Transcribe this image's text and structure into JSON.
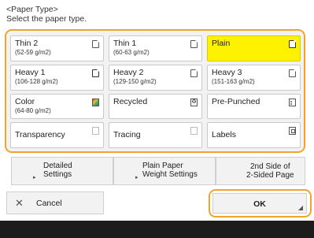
{
  "header": {
    "line1": "<Paper Type>",
    "line2": "Select the paper type."
  },
  "paper_types": [
    {
      "label": "Thin 2",
      "sub": "(52-59 g/m2)",
      "icon": "page-icon",
      "selected": false
    },
    {
      "label": "Thin 1",
      "sub": "(60-63 g/m2)",
      "icon": "page-icon",
      "selected": false
    },
    {
      "label": "Plain",
      "sub": "",
      "icon": "page-icon",
      "selected": true
    },
    {
      "label": "Heavy 1",
      "sub": "(106-128 g/m2)",
      "icon": "page-dark-icon",
      "selected": false
    },
    {
      "label": "Heavy 2",
      "sub": "(129-150 g/m2)",
      "icon": "page-icon",
      "selected": false
    },
    {
      "label": "Heavy 3",
      "sub": "(151-163 g/m2)",
      "icon": "page-icon",
      "selected": false
    },
    {
      "label": "Color",
      "sub": "(64-80 g/m2)",
      "icon": "color-paper-icon",
      "selected": false
    },
    {
      "label": "Recycled",
      "sub": "",
      "icon": "recycled-icon",
      "selected": false
    },
    {
      "label": "Pre-Punched",
      "sub": "",
      "icon": "pre-punched-icon",
      "selected": false
    },
    {
      "label": "Transparency",
      "sub": "",
      "icon": "transparency-icon",
      "selected": false
    },
    {
      "label": "Tracing",
      "sub": "",
      "icon": "tracing-icon",
      "selected": false
    },
    {
      "label": "Labels",
      "sub": "",
      "icon": "labels-icon",
      "selected": false
    }
  ],
  "options": {
    "detailed": {
      "line1": "Detailed",
      "line2": "Settings"
    },
    "plain_weight": {
      "line1": "Plain Paper",
      "line2": "Weight Settings"
    },
    "second_side": {
      "line1": "2nd Side of",
      "line2": "2-Sided Page"
    }
  },
  "actions": {
    "cancel_label": "Cancel",
    "ok_label": "OK"
  },
  "colors": {
    "highlight": "#f0a52a",
    "selected": "#fff200",
    "footer": "#1c1c1c"
  }
}
